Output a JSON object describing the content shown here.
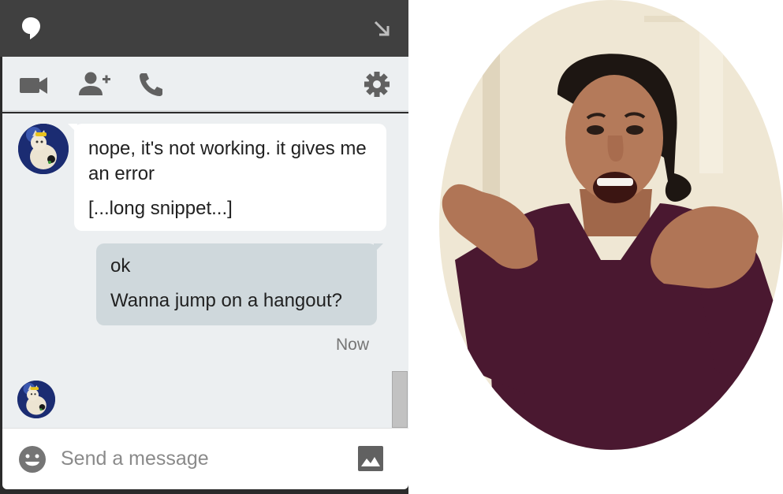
{
  "window": {
    "app_icon": "hangouts-logo-icon",
    "popout_icon": "popout-arrow-icon"
  },
  "toolbar": {
    "icons": [
      "video-call-icon",
      "add-person-icon",
      "phone-call-icon",
      "settings-gear-icon"
    ]
  },
  "conversation": {
    "incoming": {
      "lines": [
        "nope, it's not working. it gives me an error",
        "[...long snippet...]"
      ]
    },
    "outgoing": {
      "lines": [
        "ok",
        "Wanna jump on a hangout?"
      ],
      "time": "Now"
    }
  },
  "composer": {
    "placeholder": "Send a message",
    "value": "",
    "emoji_icon": "emoji-face-icon",
    "image_icon": "insert-image-icon"
  },
  "colors": {
    "title_bar": "#404040",
    "panel_bg": "#eceff1",
    "incoming_bubble": "#ffffff",
    "outgoing_bubble": "#cfd8dc",
    "sweater": "#4a1830"
  }
}
